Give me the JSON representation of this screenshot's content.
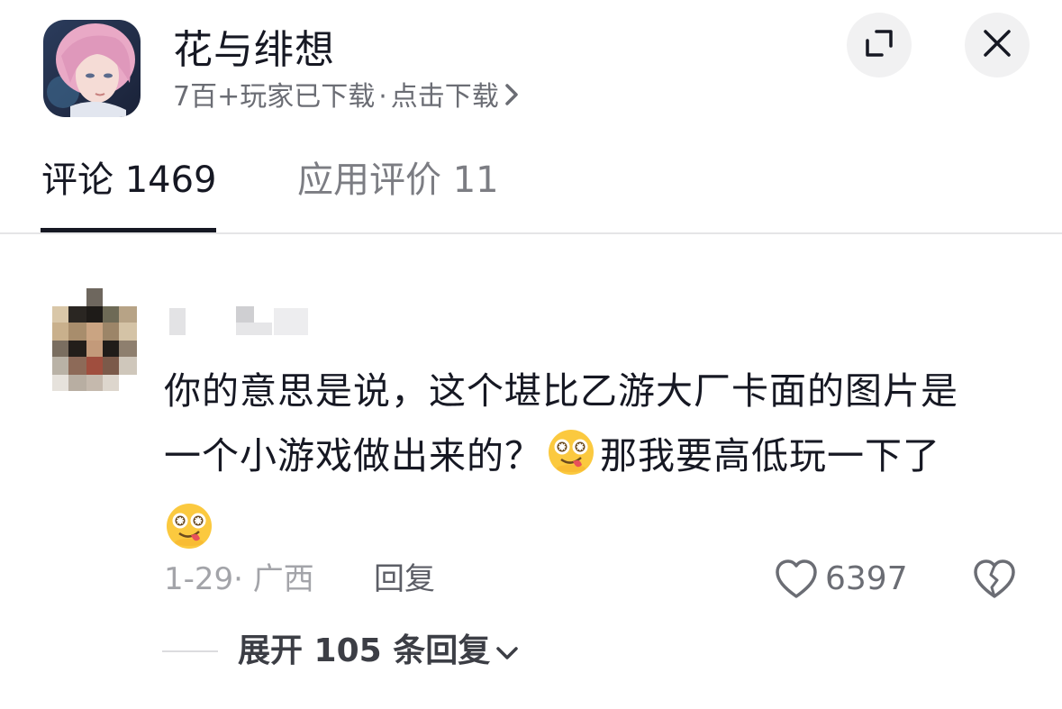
{
  "header": {
    "app_name": "花与绯想",
    "downloads_text": "7百+玩家已下载",
    "separator": "·",
    "cta_text": "点击下载",
    "icons": [
      "app-icon",
      "expand-icon",
      "close-icon",
      "chevron-right-icon"
    ]
  },
  "tabs": [
    {
      "label": "评论 1469",
      "active": true
    },
    {
      "label": "应用评价 11",
      "active": false
    }
  ],
  "comment": {
    "text_line1": "你的意思是说，这个堪比乙游大厂卡面的图片是",
    "text_line2a": "一个小游戏做出来的？",
    "text_line2b": "那我要高低玩一下了",
    "date_location": "1-29· 广西",
    "reply_label": "回复",
    "like_count": "6397",
    "icons": [
      "drooling-face-emoji",
      "heart-outline-icon",
      "broken-heart-icon"
    ]
  },
  "expand_replies": {
    "label": "展开 105 条回复"
  },
  "colors": {
    "primary_text": "#161823",
    "secondary_text": "#6b6d74",
    "muted_text": "#a3a4a9",
    "divider": "#e5e5e7",
    "button_bg": "#f1f1f2"
  }
}
